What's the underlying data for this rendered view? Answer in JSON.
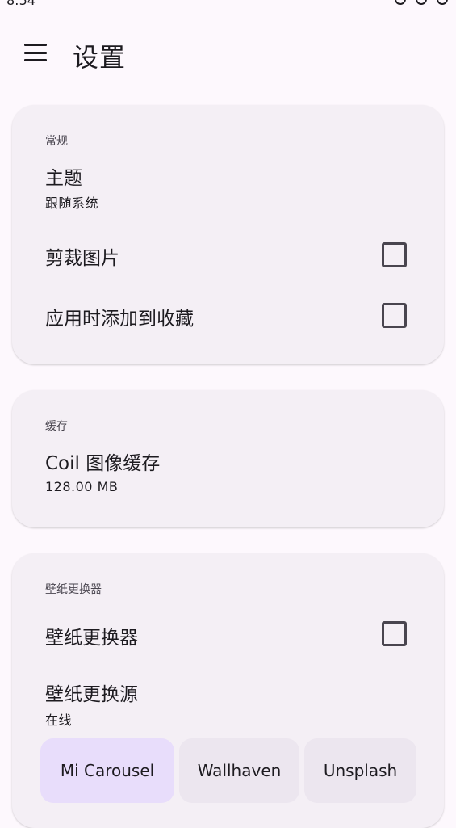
{
  "status_bar": {
    "time": "8:54"
  },
  "app_bar": {
    "title": "设置",
    "menu_icon": "hamburger-menu-icon"
  },
  "sections": {
    "general": {
      "title": "常规",
      "theme_title": "主题",
      "theme_value": "跟随系统",
      "crop_label": "剪裁图片",
      "crop_checked": false,
      "favorite_label": "应用时添加到收藏",
      "favorite_checked": false
    },
    "cache": {
      "title": "缓存",
      "coil_title": "Coil 图像缓存",
      "coil_size": "128.00 MB"
    },
    "changer": {
      "title": "壁纸更换器",
      "toggle_label": "壁纸更换器",
      "toggle_checked": false,
      "source_title": "壁纸更换源",
      "source_value": "在线",
      "chips": [
        "Mi Carousel",
        "Wallhaven",
        "Unsplash"
      ],
      "selected_chip": "Mi Carousel"
    }
  },
  "colors": {
    "background": "#fdf8fd",
    "card": "#f4eff5",
    "chip_selected": "#e8ddfb",
    "chip_default": "#ece6ef"
  }
}
